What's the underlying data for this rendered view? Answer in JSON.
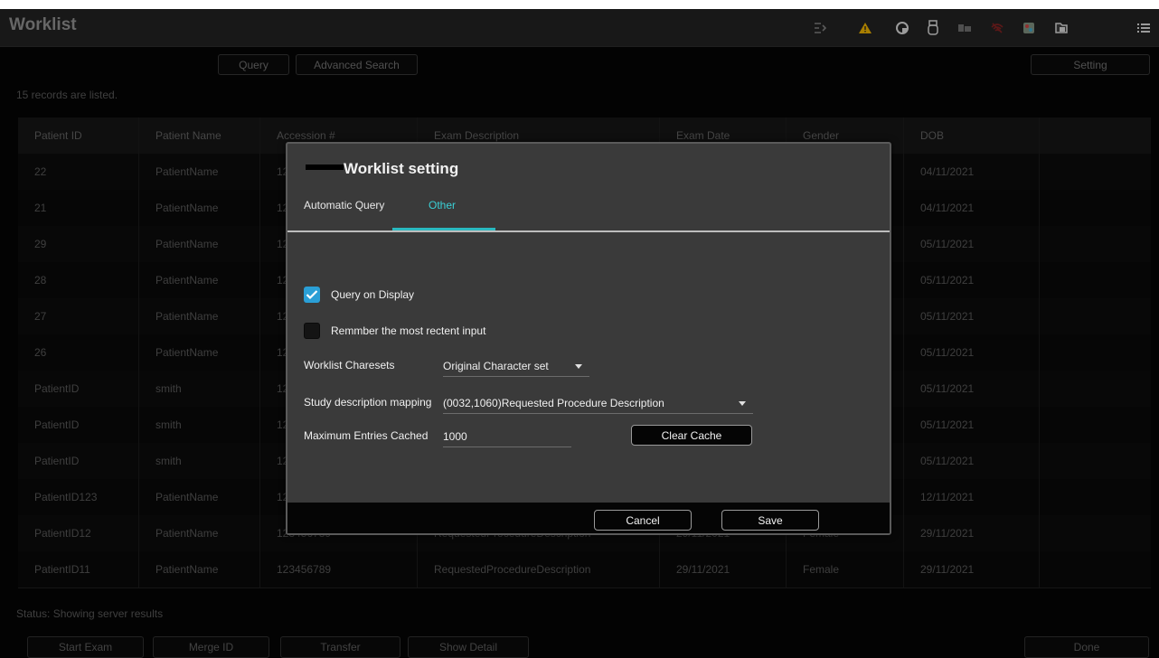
{
  "app": {
    "title": "Worklist"
  },
  "toolbar": {
    "query_label": "Query",
    "advanced_search_label": "Advanced Search",
    "setting_label": "Setting"
  },
  "records_text": "15 records are listed.",
  "table": {
    "columns": [
      "Patient ID",
      "Patient Name",
      "Accession #",
      "Exam Description",
      "Exam Date",
      "Gender",
      "DOB"
    ],
    "rows": [
      [
        "22",
        "PatientName",
        "12",
        "",
        "",
        "",
        "04/11/2021"
      ],
      [
        "21",
        "PatientName",
        "12",
        "",
        "",
        "",
        "04/11/2021"
      ],
      [
        "29",
        "PatientName",
        "12",
        "",
        "",
        "",
        "05/11/2021"
      ],
      [
        "28",
        "PatientName",
        "12",
        "",
        "",
        "",
        "05/11/2021"
      ],
      [
        "27",
        "PatientName",
        "12",
        "",
        "",
        "",
        "05/11/2021"
      ],
      [
        "26",
        "PatientName",
        "12",
        "",
        "",
        "",
        "05/11/2021"
      ],
      [
        "PatientID",
        "smith",
        "12",
        "",
        "",
        "",
        "05/11/2021"
      ],
      [
        "PatientID",
        "smith",
        "12",
        "",
        "",
        "",
        "05/11/2021"
      ],
      [
        "PatientID",
        "smith",
        "12",
        "",
        "",
        "",
        "05/11/2021"
      ],
      [
        "PatientID123",
        "PatientName",
        "12",
        "",
        "",
        "",
        "12/11/2021"
      ],
      [
        "PatientID12",
        "PatientName",
        "123456789",
        "RequestedProcedureDescription",
        "29/11/2021",
        "Female",
        "29/11/2021"
      ],
      [
        "PatientID11",
        "PatientName",
        "123456789",
        "RequestedProcedureDescription",
        "29/11/2021",
        "Female",
        "29/11/2021"
      ]
    ]
  },
  "status_text": "Status: Showing server results",
  "bottom": {
    "start_exam": "Start Exam",
    "merge_id": "Merge ID",
    "transfer": "Transfer",
    "show_detail": "Show Detail",
    "done": "Done"
  },
  "dialog": {
    "title": "Worklist setting",
    "tabs": [
      {
        "label": "Automatic Query",
        "active": false
      },
      {
        "label": "Other",
        "active": true
      }
    ],
    "query_on_display": {
      "label": "Query on Display",
      "checked": true
    },
    "remember_input": {
      "label": "Remmber the most rectent input",
      "checked": false
    },
    "charsets": {
      "label": "Worklist Charesets",
      "value": "Original Character set"
    },
    "study_mapping": {
      "label": "Study description mapping",
      "value": "(0032,1060)Requested Procedure Description"
    },
    "max_entries": {
      "label": "Maximum Entries Cached",
      "value": "1000"
    },
    "clear_cache_label": "Clear Cache",
    "cancel_label": "Cancel",
    "save_label": "Save"
  },
  "colors": {
    "accent": "#3ad0d6",
    "checkbox": "#2a9fd6",
    "alert": "#e0a800"
  },
  "icons": [
    "export-icon",
    "warning-icon",
    "network-icon",
    "usb-icon",
    "storage-icon",
    "wifi-icon",
    "print-icon",
    "folder-icon",
    "menu-icon"
  ]
}
